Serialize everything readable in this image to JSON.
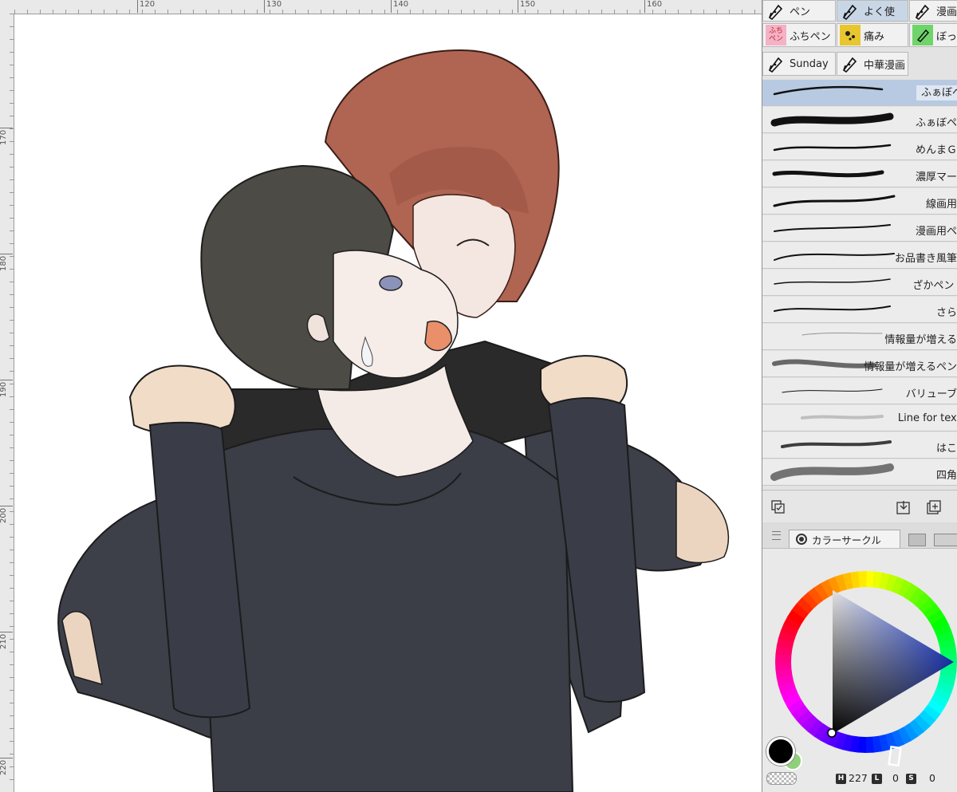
{
  "rulers": {
    "top_labels": [
      "120",
      "130",
      "140",
      "150",
      "160"
    ],
    "left_labels": [
      "170",
      "180",
      "190",
      "200",
      "210",
      "220"
    ]
  },
  "tool_tabs": [
    {
      "label": "ペン",
      "icon": "pen-nib-icon",
      "active": false
    },
    {
      "label": "よく使",
      "icon": "pen-nib-icon",
      "active": true
    },
    {
      "label": "漫画",
      "icon": "pen-tool-icon",
      "active": false
    },
    {
      "label": "ふちペン",
      "icon": "fuchi-pen-icon",
      "icon_text": "ふち\nペン",
      "active": false
    },
    {
      "label": "痛み",
      "icon": "splatter-icon",
      "active": false
    },
    {
      "label": "ぼっ",
      "icon": "green-marker-icon",
      "active": false
    },
    {
      "label": "Sunday",
      "icon": "pen-nib-icon",
      "active": false
    },
    {
      "label": "中華漫画",
      "icon": "pen-nib-icon",
      "active": false
    }
  ],
  "brushes": [
    {
      "name": "ふぁぼペ",
      "selected": true
    },
    {
      "name": "ふぁぼペン",
      "selected": false
    },
    {
      "name": "めんまＧペ",
      "selected": false
    },
    {
      "name": "濃厚マーカ",
      "selected": false
    },
    {
      "name": "線画用ペ",
      "selected": false
    },
    {
      "name": "漫画用ペン",
      "selected": false
    },
    {
      "name": "お品書き風筆ペ",
      "selected": false
    },
    {
      "name": "ざかペン　l",
      "selected": false
    },
    {
      "name": "さらペ",
      "selected": false
    },
    {
      "name": "情報量が増えるペ",
      "selected": false
    },
    {
      "name": "情報量が増えるペン改",
      "selected": false
    },
    {
      "name": "バリューブラ",
      "selected": false
    },
    {
      "name": "Line for textu",
      "selected": false
    },
    {
      "name": "はこペ",
      "selected": false
    },
    {
      "name": "四角ペ",
      "selected": false
    }
  ],
  "brush_footer": {
    "icons": [
      "select-all-icon",
      "import-brush-icon",
      "add-brush-icon"
    ]
  },
  "color_panel": {
    "tab_label": "カラーサークル",
    "tab_icon": "color-circle-icon",
    "other_tab_icons": [
      "film-icon",
      "palette-icon"
    ],
    "main_color": "#000000",
    "sub_color": "#8fd07a",
    "hsv": {
      "h_label": "H",
      "h": "227",
      "l_label": "L",
      "l": "0",
      "s_label": "S",
      "s": "0"
    }
  }
}
